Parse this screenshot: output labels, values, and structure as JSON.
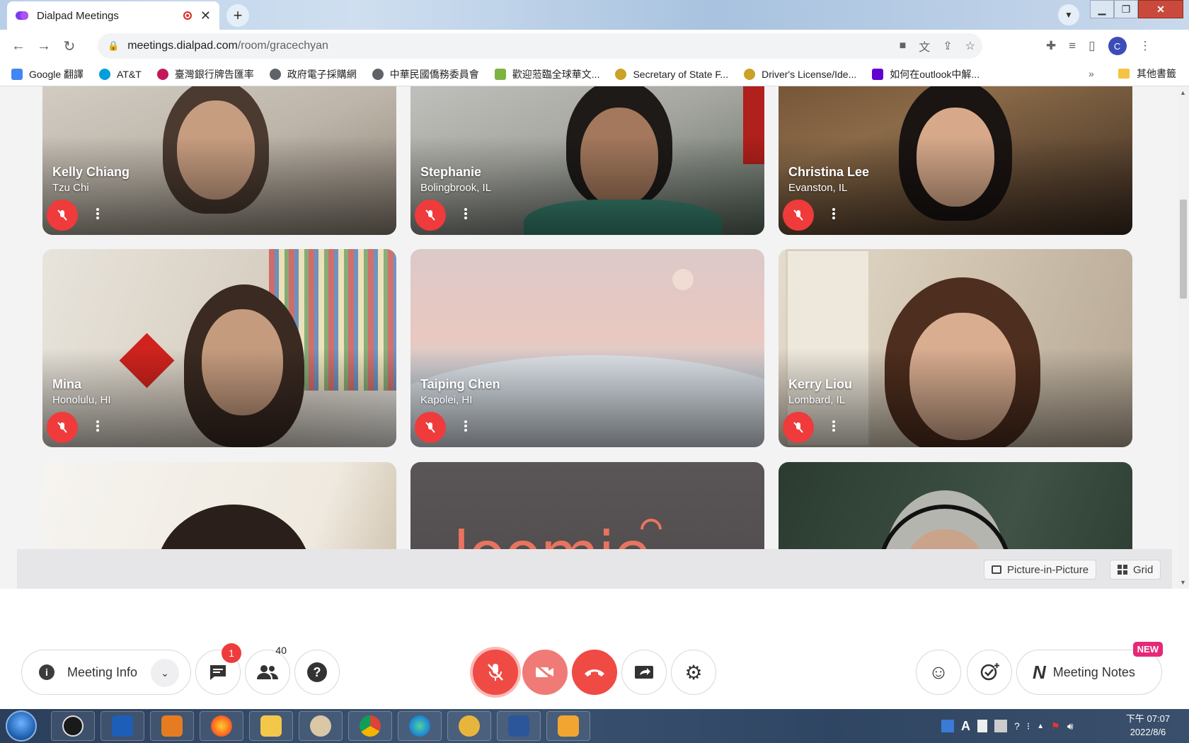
{
  "browser": {
    "tab_title": "Dialpad Meetings",
    "tab_close": "✕",
    "new_tab": "+",
    "url_host": "meetings.dialpad.com",
    "url_path": "/room/gracechyan",
    "profile_initial": "C"
  },
  "bookmarks": [
    {
      "label": "Google 翻譯",
      "color": "#4285f4"
    },
    {
      "label": "AT&T",
      "color": "#009fdb"
    },
    {
      "label": "臺灣銀行牌告匯率",
      "color": "#c2185b"
    },
    {
      "label": "政府電子採購網",
      "color": "#5f6368"
    },
    {
      "label": "中華民國僑務委員會",
      "color": "#5f6368"
    },
    {
      "label": "歡迎蒞臨全球華文...",
      "color": "#7cb342"
    },
    {
      "label": "Secretary of State F...",
      "color": "#c9a227"
    },
    {
      "label": "Driver's License/Ide...",
      "color": "#c9a227"
    },
    {
      "label": "如何在outlook中解...",
      "color": "#6001d2"
    }
  ],
  "bookmarks_more": "»",
  "bookmarks_other": "其他書籤",
  "participants": [
    {
      "name": "Kelly Chiang",
      "location": "Tzu Chi"
    },
    {
      "name": "Stephanie",
      "location": "Bolingbrook, IL"
    },
    {
      "name": "Christina Lee",
      "location": "Evanston, IL"
    },
    {
      "name": "Mina",
      "location": "Honolulu, HI"
    },
    {
      "name": "Taiping Chen",
      "location": "Kapolei, HI"
    },
    {
      "name": "Kerry Liou",
      "location": "Lombard, IL"
    }
  ],
  "loomie_text": "loomie live",
  "view": {
    "pip_label": "Picture-in-Picture",
    "grid_label": "Grid"
  },
  "controls": {
    "meeting_info_label": "Meeting Info",
    "chat_badge": "1",
    "participants_count": "40",
    "meeting_notes_label": "Meeting Notes",
    "new_badge": "NEW"
  },
  "taskbar": {
    "time": "下午 07:07",
    "date": "2022/8/6",
    "ime": "A"
  },
  "colors": {
    "accent_red": "#f04a45",
    "muted_red": "#ef3b3b",
    "new_badge": "#e62877"
  }
}
